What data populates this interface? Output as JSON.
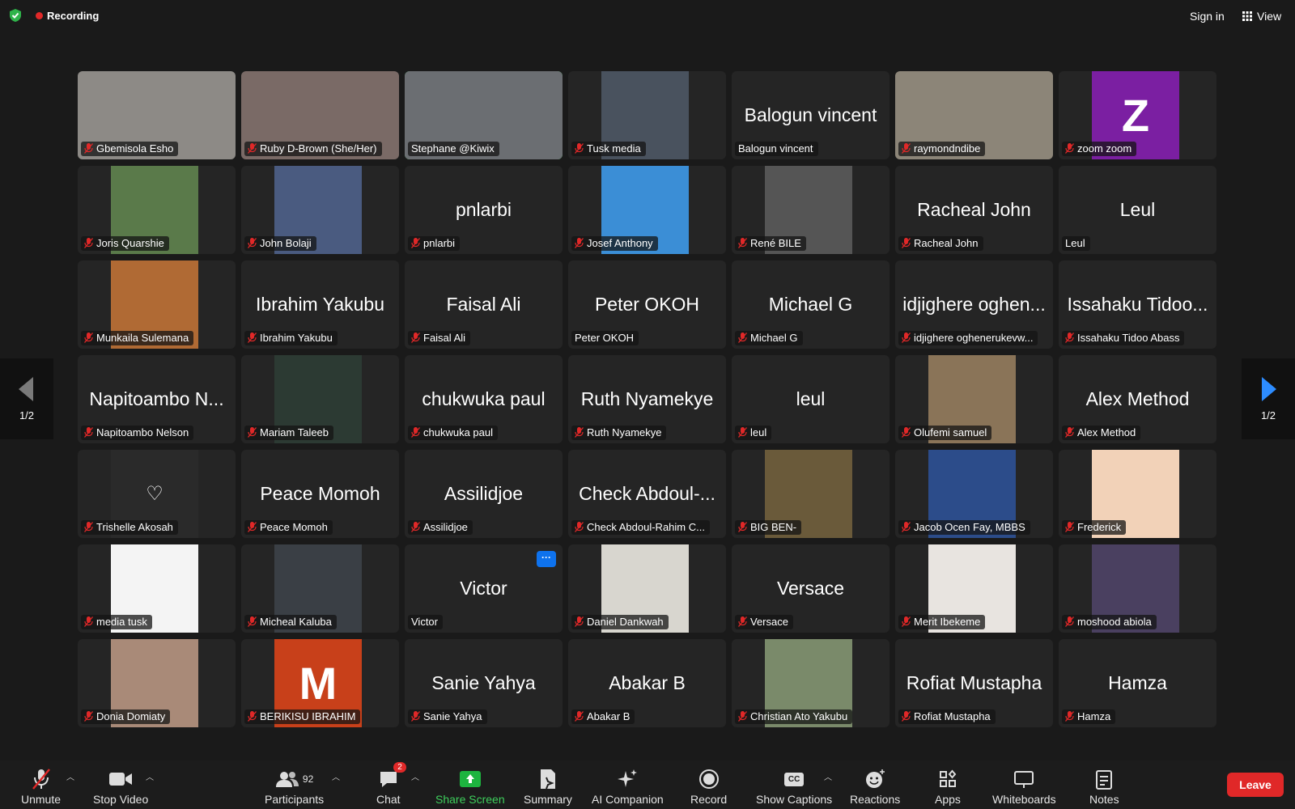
{
  "top": {
    "recording": "Recording",
    "sign_in": "Sign in",
    "view": "View"
  },
  "tiles": [
    {
      "name": "Gbemisola Esho",
      "big": "",
      "muted": true,
      "photo": "full",
      "color": "#8d8a86"
    },
    {
      "name": "Ruby D-Brown (She/Her)",
      "big": "",
      "muted": true,
      "photo": "full",
      "color": "#7a6a66"
    },
    {
      "name": "Stephane @Kiwix",
      "big": "",
      "muted": false,
      "photo": "full",
      "color": "#6b6e72",
      "active": true
    },
    {
      "name": "Tusk media",
      "big": "",
      "muted": true,
      "photo": "center",
      "color": "#49525e"
    },
    {
      "name": "Balogun vincent",
      "big": "Balogun vincent",
      "muted": false
    },
    {
      "name": "raymondndibe",
      "big": "",
      "muted": true,
      "photo": "full",
      "color": "#8c8578"
    },
    {
      "name": "zoom zoom",
      "big": "",
      "muted": true,
      "photo": "center",
      "color": "#7b1fa2",
      "letter": "Z"
    },
    {
      "name": "Joris Quarshie",
      "big": "",
      "muted": true,
      "photo": "center",
      "color": "#5a7a4a"
    },
    {
      "name": "John Bolaji",
      "big": "",
      "muted": true,
      "photo": "center",
      "color": "#4a5b80"
    },
    {
      "name": "pnlarbi",
      "big": "pnlarbi",
      "muted": true
    },
    {
      "name": "Josef Anthony",
      "big": "",
      "muted": true,
      "photo": "center",
      "color": "#3b8ed6"
    },
    {
      "name": "René BILE",
      "big": "",
      "muted": true,
      "photo": "center",
      "color": "#555555"
    },
    {
      "name": "Racheal John",
      "big": "Racheal John",
      "muted": true
    },
    {
      "name": "Leul",
      "big": "Leul",
      "muted": false
    },
    {
      "name": "Munkaila Sulemana",
      "big": "",
      "muted": true,
      "photo": "center",
      "color": "#b06a34"
    },
    {
      "name": "Ibrahim Yakubu",
      "big": "Ibrahim Yakubu",
      "muted": true
    },
    {
      "name": "Faisal Ali",
      "big": "Faisal Ali",
      "muted": true
    },
    {
      "name": "Peter OKOH",
      "big": "Peter OKOH",
      "muted": false
    },
    {
      "name": "Michael G",
      "big": "Michael G",
      "muted": true
    },
    {
      "name": "idjighere oghenerukevw...",
      "big": "idjighere oghen...",
      "muted": true
    },
    {
      "name": "Issahaku Tidoo Abass",
      "big": "Issahaku Tidoo...",
      "muted": true
    },
    {
      "name": "Napitoambo Nelson",
      "big": "Napitoambo N...",
      "muted": true
    },
    {
      "name": "Mariam Taleeb",
      "big": "",
      "muted": true,
      "photo": "center",
      "color": "#2c3a33"
    },
    {
      "name": "chukwuka paul",
      "big": "chukwuka paul",
      "muted": true
    },
    {
      "name": "Ruth Nyamekye",
      "big": "Ruth Nyamekye",
      "muted": true
    },
    {
      "name": "leul",
      "big": "leul",
      "muted": true
    },
    {
      "name": "Olufemi samuel",
      "big": "",
      "muted": true,
      "photo": "center",
      "color": "#8a7458"
    },
    {
      "name": "Alex Method",
      "big": "Alex Method",
      "muted": true
    },
    {
      "name": "Trishelle Akosah",
      "big": "",
      "muted": true,
      "photo": "center",
      "color": "#2a2a2a",
      "heart": "♡"
    },
    {
      "name": "Peace Momoh",
      "big": "Peace Momoh",
      "muted": true
    },
    {
      "name": "Assilidjoe",
      "big": "Assilidjoe",
      "muted": true
    },
    {
      "name": "Check Abdoul-Rahim C...",
      "big": "Check Abdoul-...",
      "muted": true
    },
    {
      "name": "BIG BEN-",
      "big": "",
      "muted": true,
      "photo": "center",
      "color": "#6a5a3a"
    },
    {
      "name": "Jacob Ocen Fay, MBBS",
      "big": "",
      "muted": true,
      "photo": "center",
      "color": "#2c4c8a"
    },
    {
      "name": "Frederick",
      "big": "",
      "muted": true,
      "photo": "center",
      "color": "#f2d2b8"
    },
    {
      "name": "media tusk",
      "big": "",
      "muted": true,
      "photo": "center",
      "color": "#f4f4f4"
    },
    {
      "name": "Micheal Kaluba",
      "big": "",
      "muted": true,
      "photo": "center",
      "color": "#3a3f45"
    },
    {
      "name": "Victor",
      "big": "Victor",
      "muted": false,
      "more": "···"
    },
    {
      "name": "Daniel Dankwah",
      "big": "",
      "muted": true,
      "photo": "center",
      "color": "#d8d6cf"
    },
    {
      "name": "Versace",
      "big": "Versace",
      "muted": true
    },
    {
      "name": "Merit Ibekeme",
      "big": "",
      "muted": true,
      "photo": "center",
      "color": "#e8e4e0"
    },
    {
      "name": "moshood abiola",
      "big": "",
      "muted": true,
      "photo": "center",
      "color": "#4a4060"
    },
    {
      "name": "Donia Domiaty",
      "big": "",
      "muted": true,
      "photo": "center",
      "color": "#a98a78"
    },
    {
      "name": "BERIKISU IBRAHIM",
      "big": "",
      "muted": true,
      "photo": "center",
      "color": "#c8401a",
      "letter": "M"
    },
    {
      "name": "Sanie Yahya",
      "big": "Sanie Yahya",
      "muted": true
    },
    {
      "name": "Abakar B",
      "big": "Abakar B",
      "muted": true
    },
    {
      "name": "Christian Ato Yakubu",
      "big": "",
      "muted": true,
      "photo": "center",
      "color": "#7a8a6a"
    },
    {
      "name": "Rofiat Mustapha",
      "big": "Rofiat Mustapha",
      "muted": true
    },
    {
      "name": "Hamza",
      "big": "Hamza",
      "muted": true
    }
  ],
  "nav": {
    "page": "1/2"
  },
  "toolbar": {
    "unmute": "Unmute",
    "stop_video": "Stop Video",
    "participants": "Participants",
    "participants_count": "92",
    "chat": "Chat",
    "chat_badge": "2",
    "share": "Share Screen",
    "summary": "Summary",
    "ai": "AI Companion",
    "record": "Record",
    "captions": "Show Captions",
    "captions_icon": "CC",
    "reactions": "Reactions",
    "apps": "Apps",
    "whiteboards": "Whiteboards",
    "notes": "Notes",
    "leave": "Leave"
  },
  "colors": {
    "accent_green": "#34c451",
    "leave_red": "#e02828",
    "share_green": "#1db43f",
    "blue": "#0e72ed"
  }
}
